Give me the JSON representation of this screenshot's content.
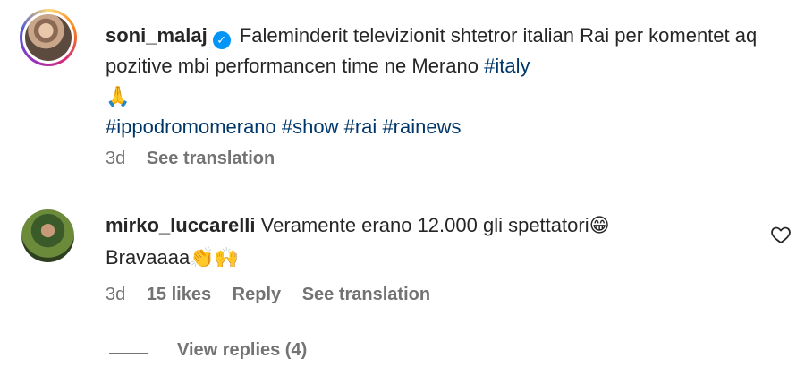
{
  "post": {
    "username": "soni_malaj",
    "caption_text": "Faleminderit televizionit shtetror italian Rai per komentet aq pozitive mbi performancen time ne Merano",
    "hashtag_italy": "#italy",
    "emoji": "🙏",
    "hashtags": [
      "#ippodromomerano",
      "#show",
      "#rai",
      "#rainews"
    ],
    "time": "3d",
    "see_translation": "See translation"
  },
  "comment": {
    "username": "mirko_luccarelli",
    "text": "Veramente erano 12.000 gli spettatori",
    "emoji1": "😁",
    "line2": "Bravaaaa",
    "emoji2": "👏",
    "emoji3": "🙌",
    "time": "3d",
    "likes": "15 likes",
    "reply": "Reply",
    "see_translation": "See translation",
    "view_replies": "View replies (4)"
  },
  "icons": {
    "verified": "verified-badge-icon",
    "heart": "heart-outline-icon"
  },
  "colors": {
    "hashtag": "#00376b",
    "verified": "#0095f6",
    "secondary_text": "#737373"
  }
}
